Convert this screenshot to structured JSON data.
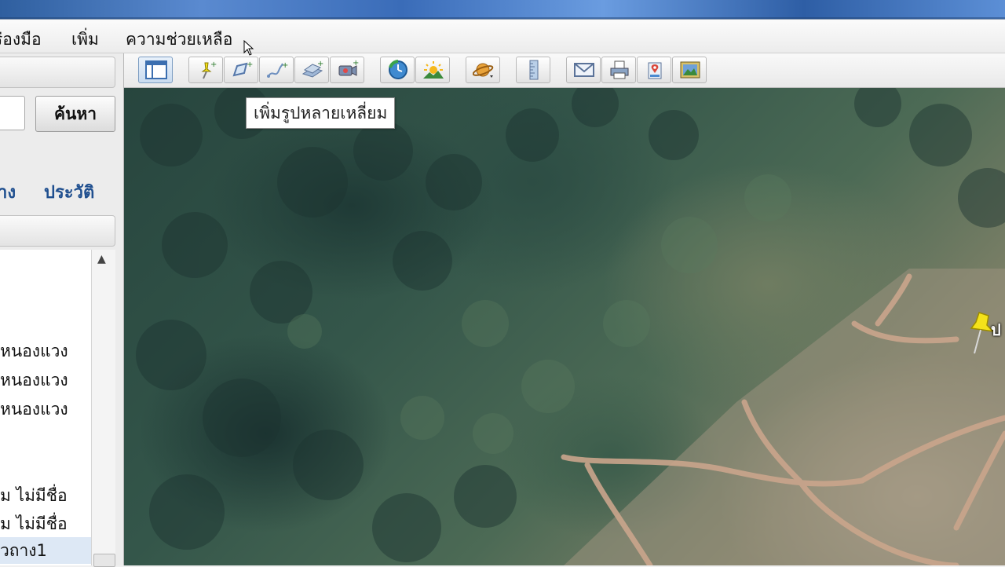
{
  "menubar": {
    "items": [
      "ร่องมือ",
      "เพิ่ม",
      "ความช่วยเหลือ"
    ]
  },
  "toolbar": {
    "buttons": [
      {
        "icon": "sidebar-toggle-icon",
        "selected": true
      },
      {
        "icon": "add-placemark-icon"
      },
      {
        "icon": "add-polygon-icon"
      },
      {
        "icon": "add-path-icon"
      },
      {
        "icon": "add-image-overlay-icon"
      },
      {
        "icon": "record-tour-icon"
      },
      {
        "icon": "historical-imagery-icon"
      },
      {
        "icon": "sunlight-icon"
      },
      {
        "icon": "planet-icon"
      },
      {
        "icon": "ruler-icon"
      },
      {
        "icon": "email-icon"
      },
      {
        "icon": "print-icon"
      },
      {
        "icon": "view-in-maps-icon"
      },
      {
        "icon": "save-image-icon"
      }
    ]
  },
  "tooltip": {
    "text": "เพิ่มรูปหลายเหลี่ยม"
  },
  "sidebar": {
    "search_button": "ค้นหา",
    "tabs": [
      "าง",
      "ประวัติ"
    ],
    "places": [
      "หนองแวง",
      "หนองแวง",
      "หนองแวง",
      "ม ไม่มีชื่อ",
      "ม ไม่มีชื่อ",
      "วถาง1"
    ]
  },
  "map": {
    "placemark_label": "ป"
  },
  "colors": {
    "placemark": "#f4e21a",
    "tab_text": "#1f4f8f",
    "selected_row": "#dde8f5"
  }
}
